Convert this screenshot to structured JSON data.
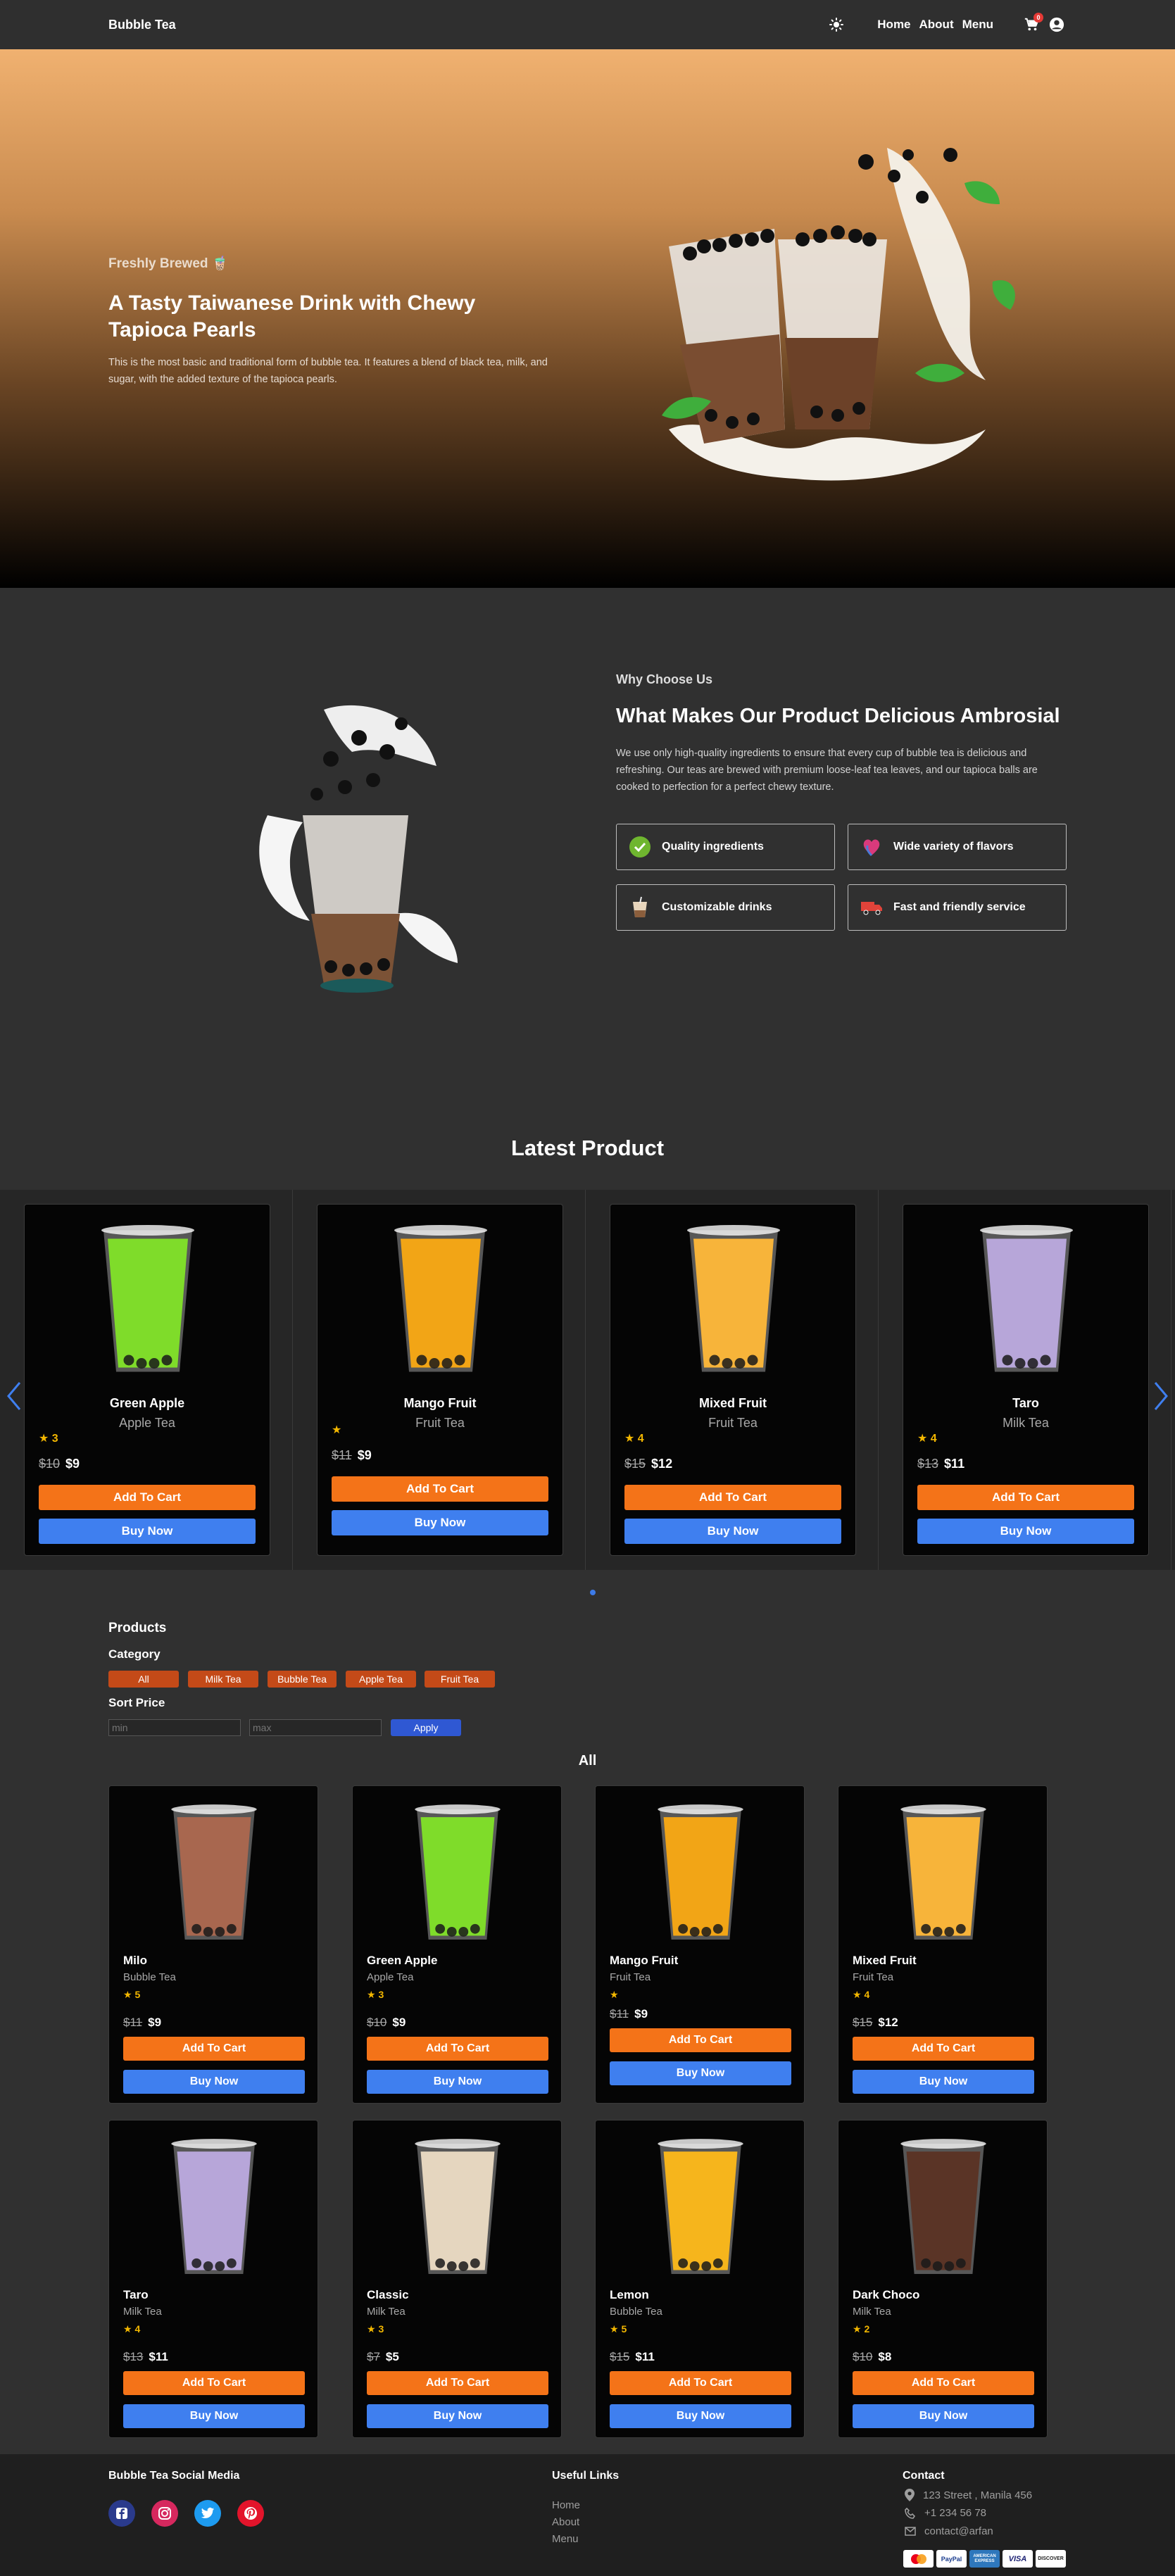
{
  "nav": {
    "brand": "Bubble Tea",
    "links": [
      "Home",
      "About",
      "Menu"
    ],
    "cart_count": "0"
  },
  "hero": {
    "subtitle": "Freshly Brewed 🧋",
    "title": "A Tasty Taiwanese Drink with Chewy Tapioca Pearls",
    "description": "This is the most basic and traditional form of bubble tea. It features a blend of black tea, milk, and sugar, with the added texture of the tapioca pearls."
  },
  "why": {
    "subtitle": "Why Choose Us",
    "title": "What Makes Our Product Delicious Ambrosial",
    "description": "We use only high-quality ingredients to ensure that every cup of bubble tea is delicious and refreshing. Our teas are brewed with premium loose-leaf tea leaves, and our tapioca balls are cooked to perfection for a perfect chewy texture.",
    "features": [
      {
        "label": "Quality ingredients",
        "icon": "check-badge-icon"
      },
      {
        "label": "Wide variety of flavors",
        "icon": "rainbow-heart-icon"
      },
      {
        "label": "Customizable drinks",
        "icon": "drink-cup-icon"
      },
      {
        "label": "Fast and friendly service",
        "icon": "delivery-truck-icon"
      }
    ]
  },
  "latest": {
    "title": "Latest Product",
    "items": [
      {
        "name": "Green Apple",
        "category": "Apple Tea",
        "rating": "3",
        "old_price": "$10",
        "price": "$9",
        "color": "#7fdc2a"
      },
      {
        "name": "Mango Fruit",
        "category": "Fruit Tea",
        "rating": "",
        "old_price": "$11",
        "price": "$9",
        "color": "#f2a516"
      },
      {
        "name": "Mixed Fruit",
        "category": "Fruit Tea",
        "rating": "4",
        "old_price": "$15",
        "price": "$12",
        "color": "#f7b43a"
      },
      {
        "name": "Taro",
        "category": "Milk Tea",
        "rating": "4",
        "old_price": "$13",
        "price": "$11",
        "color": "#b7a6d9"
      }
    ],
    "add_label": "Add To Cart",
    "buy_label": "Buy Now"
  },
  "products": {
    "heading": "Products",
    "category_label": "Category",
    "categories": [
      "All",
      "Milk Tea",
      "Bubble Tea",
      "Apple Tea",
      "Fruit Tea"
    ],
    "sort_label": "Sort Price",
    "min_placeholder": "min",
    "max_placeholder": "max",
    "apply_label": "Apply",
    "current_filter": "All",
    "items": [
      {
        "name": "Milo",
        "category": "Bubble Tea",
        "rating": "5",
        "old_price": "$11",
        "price": "$9",
        "color": "#a8674f"
      },
      {
        "name": "Green Apple",
        "category": "Apple Tea",
        "rating": "3",
        "old_price": "$10",
        "price": "$9",
        "color": "#7fdc2a"
      },
      {
        "name": "Mango Fruit",
        "category": "Fruit Tea",
        "rating": "",
        "old_price": "$11",
        "price": "$9",
        "color": "#f2a516"
      },
      {
        "name": "Mixed Fruit",
        "category": "Fruit Tea",
        "rating": "4",
        "old_price": "$15",
        "price": "$12",
        "color": "#f7b43a"
      },
      {
        "name": "Taro",
        "category": "Milk Tea",
        "rating": "4",
        "old_price": "$13",
        "price": "$11",
        "color": "#b7a6d9"
      },
      {
        "name": "Classic",
        "category": "Milk Tea",
        "rating": "3",
        "old_price": "$7",
        "price": "$5",
        "color": "#e5d6bf"
      },
      {
        "name": "Lemon",
        "category": "Bubble Tea",
        "rating": "5",
        "old_price": "$15",
        "price": "$11",
        "color": "#f6b51c"
      },
      {
        "name": "Dark Choco",
        "category": "Milk Tea",
        "rating": "2",
        "old_price": "$10",
        "price": "$8",
        "color": "#5a3426"
      }
    ]
  },
  "footer": {
    "social_heading": "Bubble Tea Social Media",
    "links_heading": "Useful Links",
    "links": [
      "Home",
      "About",
      "Menu"
    ],
    "contact_heading": "Contact",
    "address": "123 Street , Manila 456",
    "phone": "+1 234 56 78",
    "email": "contact@arfan",
    "payments": [
      "mastercard",
      "PayPal",
      "AMERICAN EXPRESS",
      "VISA",
      "DISCOVER"
    ]
  },
  "colors": {
    "accent_orange": "#f47318",
    "accent_blue": "#3f7fef",
    "chip": "#c44a18",
    "star": "#f3b700"
  }
}
